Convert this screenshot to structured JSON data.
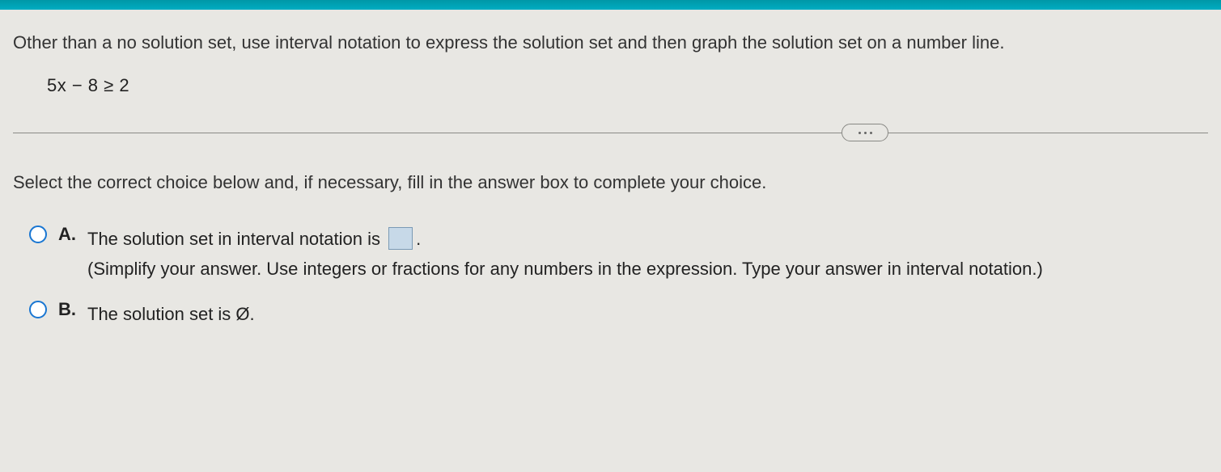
{
  "question": {
    "instruction": "Other than a no solution set, use interval notation to express the solution set and then graph the solution set on a number line.",
    "equation": "5x − 8 ≥ 2"
  },
  "select_instruction": "Select the correct choice below and, if necessary, fill in the answer box to complete your choice.",
  "options": {
    "a": {
      "label": "A.",
      "text_before": "The solution set in interval notation is ",
      "text_after": ".",
      "hint": "(Simplify your answer. Use integers or fractions for any numbers in the expression. Type your answer in interval notation.)"
    },
    "b": {
      "label": "B.",
      "text": "The solution set is Ø."
    }
  }
}
